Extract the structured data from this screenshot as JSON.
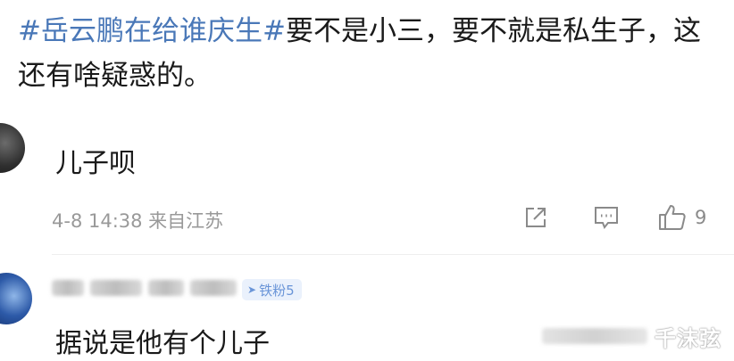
{
  "post": {
    "topic": "#岳云鹏在给谁庆生#",
    "body": "要不是小三，要不就是私生子，这还有啥疑惑的。"
  },
  "comments": [
    {
      "text": "儿子呗",
      "meta": "4-8 14:38 来自江苏",
      "like_count": "9"
    },
    {
      "badge": "铁粉5",
      "text": "据说是他有个儿子"
    }
  ],
  "watermark": {
    "text": "千沫弦"
  },
  "icons": {
    "share": "share-icon",
    "comment": "comment-icon",
    "like": "like-icon"
  },
  "colors": {
    "topic_link": "#4a78b8",
    "meta_gray": "#999999",
    "badge_text": "#6a95d8",
    "badge_bg": "#eaf1fc"
  }
}
